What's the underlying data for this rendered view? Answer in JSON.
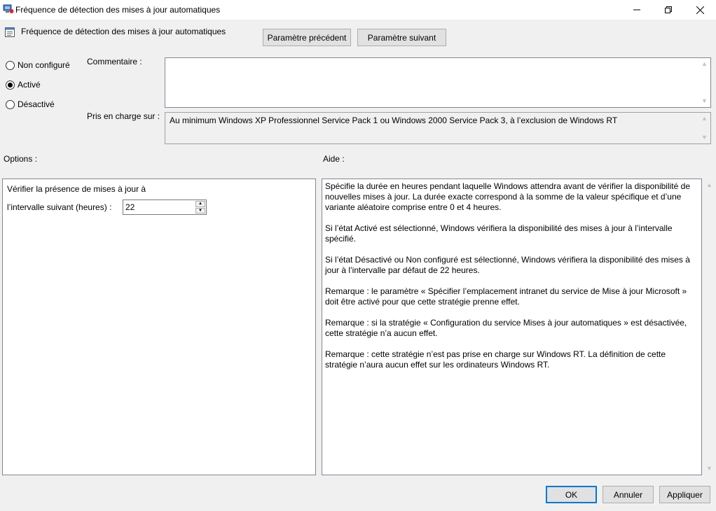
{
  "window": {
    "title": "Fréquence de détection des mises à jour automatiques",
    "controls": {
      "minimize": "—",
      "maximize": "❐",
      "close": "✕"
    }
  },
  "header": {
    "policy_name": "Fréquence de détection des mises à jour automatiques",
    "prev_button": "Paramètre précédent",
    "next_button": "Paramètre suivant"
  },
  "state": {
    "options": [
      {
        "label": "Non configuré",
        "selected": false
      },
      {
        "label": "Activé",
        "selected": true
      },
      {
        "label": "Désactivé",
        "selected": false
      }
    ]
  },
  "comment": {
    "label": "Commentaire :",
    "value": ""
  },
  "supported": {
    "label": "Pris en charge sur :",
    "value": "Au minimum Windows XP Professionnel Service Pack 1 ou Windows 2000 Service Pack 3, à l’exclusion de Windows RT"
  },
  "options_section": {
    "label": "Options :",
    "line1": "Vérifier la présence de mises à jour à",
    "interval_label": "l’intervalle suivant (heures) :",
    "interval_value": "22"
  },
  "help_section": {
    "label": "Aide :",
    "paragraphs": [
      "Spécifie la durée en heures pendant laquelle Windows attendra avant de vérifier la disponibilité de nouvelles mises à jour. La durée exacte correspond à la somme de la valeur spécifique et d’une variante aléatoire comprise entre 0 et 4 heures.",
      "Si l’état Activé est sélectionné, Windows vérifiera la disponibilité des mises à jour à l’intervalle spécifié.",
      "Si l’état Désactivé ou Non configuré est sélectionné, Windows vérifiera la disponibilité des mises à jour à l’intervalle par défaut de 22 heures.",
      "Remarque : le paramètre « Spécifier l’emplacement intranet du service de Mise à jour Microsoft » doit être activé pour que cette stratégie prenne effet.",
      "Remarque : si la stratégie « Configuration du service Mises à jour automatiques » est désactivée, cette stratégie n’a aucun effet.",
      "Remarque : cette stratégie n’est pas prise en charge sur Windows RT. La définition de cette stratégie n’aura aucun effet sur les ordinateurs Windows RT."
    ]
  },
  "footer": {
    "ok": "OK",
    "cancel": "Annuler",
    "apply": "Appliquer"
  },
  "colors": {
    "accent": "#0078d7",
    "background": "#f0f0f0"
  }
}
